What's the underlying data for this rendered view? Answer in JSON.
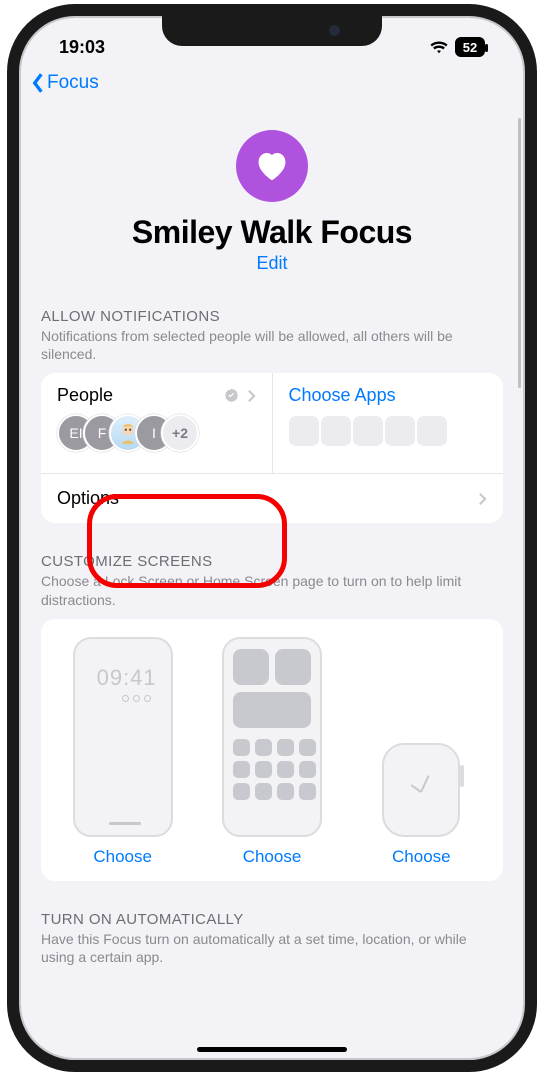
{
  "status": {
    "time": "19:03",
    "battery": "52"
  },
  "nav": {
    "back_label": "Focus"
  },
  "hero": {
    "title": "Smiley Walk Focus",
    "edit": "Edit"
  },
  "notif": {
    "header": "ALLOW NOTIFICATIONS",
    "desc": "Notifications from selected people will be allowed, all others will be silenced.",
    "people_label": "People",
    "apps_label": "Choose Apps",
    "options_label": "Options",
    "avatars": [
      "EI",
      "F",
      "",
      "I"
    ],
    "more": "+2"
  },
  "screens": {
    "header": "CUSTOMIZE SCREENS",
    "desc": "Choose a Lock Screen or Home Screen page to turn on to help limit distractions.",
    "lock_time": "09:41",
    "choose": "Choose"
  },
  "auto": {
    "header": "TURN ON AUTOMATICALLY",
    "desc": "Have this Focus turn on automatically at a set time, location, or while using a certain app."
  }
}
